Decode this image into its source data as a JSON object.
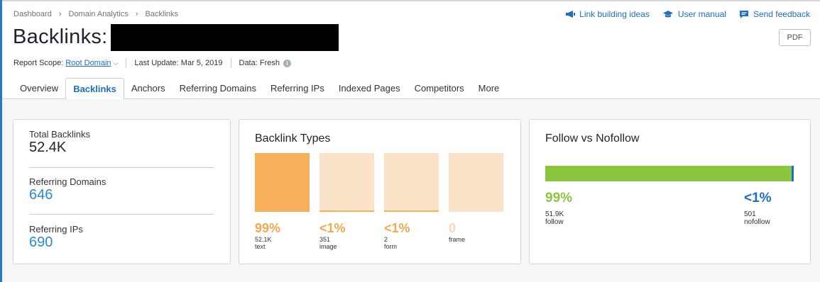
{
  "breadcrumb": [
    "Dashboard",
    "Domain Analytics",
    "Backlinks"
  ],
  "header_links": {
    "link_building": "Link building ideas",
    "user_manual": "User manual",
    "send_feedback": "Send feedback"
  },
  "page_title": "Backlinks:",
  "pdf_label": "PDF",
  "meta": {
    "scope_label": "Report Scope:",
    "scope_value": "Root Domain",
    "last_update": "Last Update: Mar 5, 2019",
    "data": "Data: Fresh"
  },
  "tabs": [
    "Overview",
    "Backlinks",
    "Anchors",
    "Referring Domains",
    "Referring IPs",
    "Indexed Pages",
    "Competitors",
    "More"
  ],
  "active_tab": "Backlinks",
  "stats": [
    {
      "label": "Total Backlinks",
      "value": "52.4K"
    },
    {
      "label": "Referring Domains",
      "value": "646"
    },
    {
      "label": "Referring IPs",
      "value": "690"
    }
  ],
  "backlink_types": {
    "title": "Backlink Types",
    "items": [
      {
        "pct": "99%",
        "count": "52.1K",
        "name": "text"
      },
      {
        "pct": "<1%",
        "count": "351",
        "name": "image"
      },
      {
        "pct": "<1%",
        "count": "2",
        "name": "form"
      },
      {
        "pct": "0",
        "count": "",
        "name": "frame"
      }
    ]
  },
  "follow": {
    "title": "Follow vs Nofollow",
    "follow_pct": "99%",
    "follow_count": "51.9K",
    "follow_label": "follow",
    "nofollow_pct": "<1%",
    "nofollow_count": "501",
    "nofollow_label": "nofollow"
  },
  "colors": {
    "accent_blue": "#1d6fc4",
    "stat_blue": "#2a89d6",
    "orange": "#f6b05a",
    "orange_light": "#fbe3c9",
    "follow_green": "#8cc63e"
  }
}
